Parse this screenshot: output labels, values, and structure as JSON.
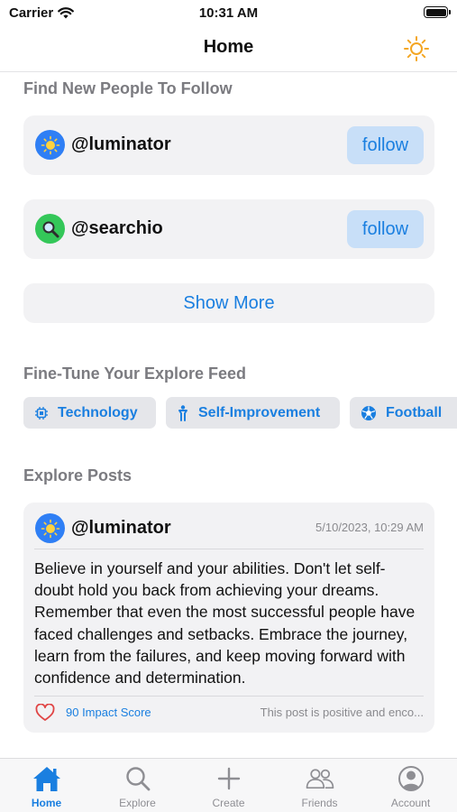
{
  "status_bar": {
    "carrier": "Carrier",
    "time": "10:31 AM"
  },
  "nav": {
    "title": "Home",
    "theme_icon": "sun-icon"
  },
  "follow_section": {
    "title": "Find New People To Follow",
    "users": [
      {
        "handle": "@luminator",
        "avatar_icon": "sun-avatar-icon",
        "avatar_color": "#2f7ff5",
        "button_label": "follow"
      },
      {
        "handle": "@searchio",
        "avatar_icon": "magnifier-avatar-icon",
        "avatar_color": "#34c759",
        "button_label": "follow"
      }
    ],
    "show_more_label": "Show More"
  },
  "feed_section": {
    "title": "Fine-Tune Your Explore Feed",
    "chips": [
      {
        "label": "Technology",
        "icon": "chip-icon"
      },
      {
        "label": "Self-Improvement",
        "icon": "person-icon"
      },
      {
        "label": "Football",
        "icon": "soccer-ball-icon"
      }
    ]
  },
  "posts_section": {
    "title": "Explore Posts",
    "post": {
      "handle": "@luminator",
      "date": "5/10/2023, 10:29 AM",
      "body": "Believe in yourself and your abilities. Don't let self-doubt hold you back from achieving your dreams. Remember that even the most successful people have faced challenges and setbacks. Embrace the journey, learn from the failures, and keep moving forward with confidence and determination.",
      "impact": "90 Impact Score",
      "sentiment": "This post is positive and enco..."
    }
  },
  "tabs": [
    {
      "label": "Home",
      "icon": "house-icon",
      "active": true
    },
    {
      "label": "Explore",
      "icon": "search-icon",
      "active": false
    },
    {
      "label": "Create",
      "icon": "plus-icon",
      "active": false
    },
    {
      "label": "Friends",
      "icon": "people-icon",
      "active": false
    },
    {
      "label": "Account",
      "icon": "account-icon",
      "active": false
    }
  ],
  "colors": {
    "accent": "#1a7fe0",
    "theme_icon": "#f4a623",
    "heart": "#e04545"
  }
}
